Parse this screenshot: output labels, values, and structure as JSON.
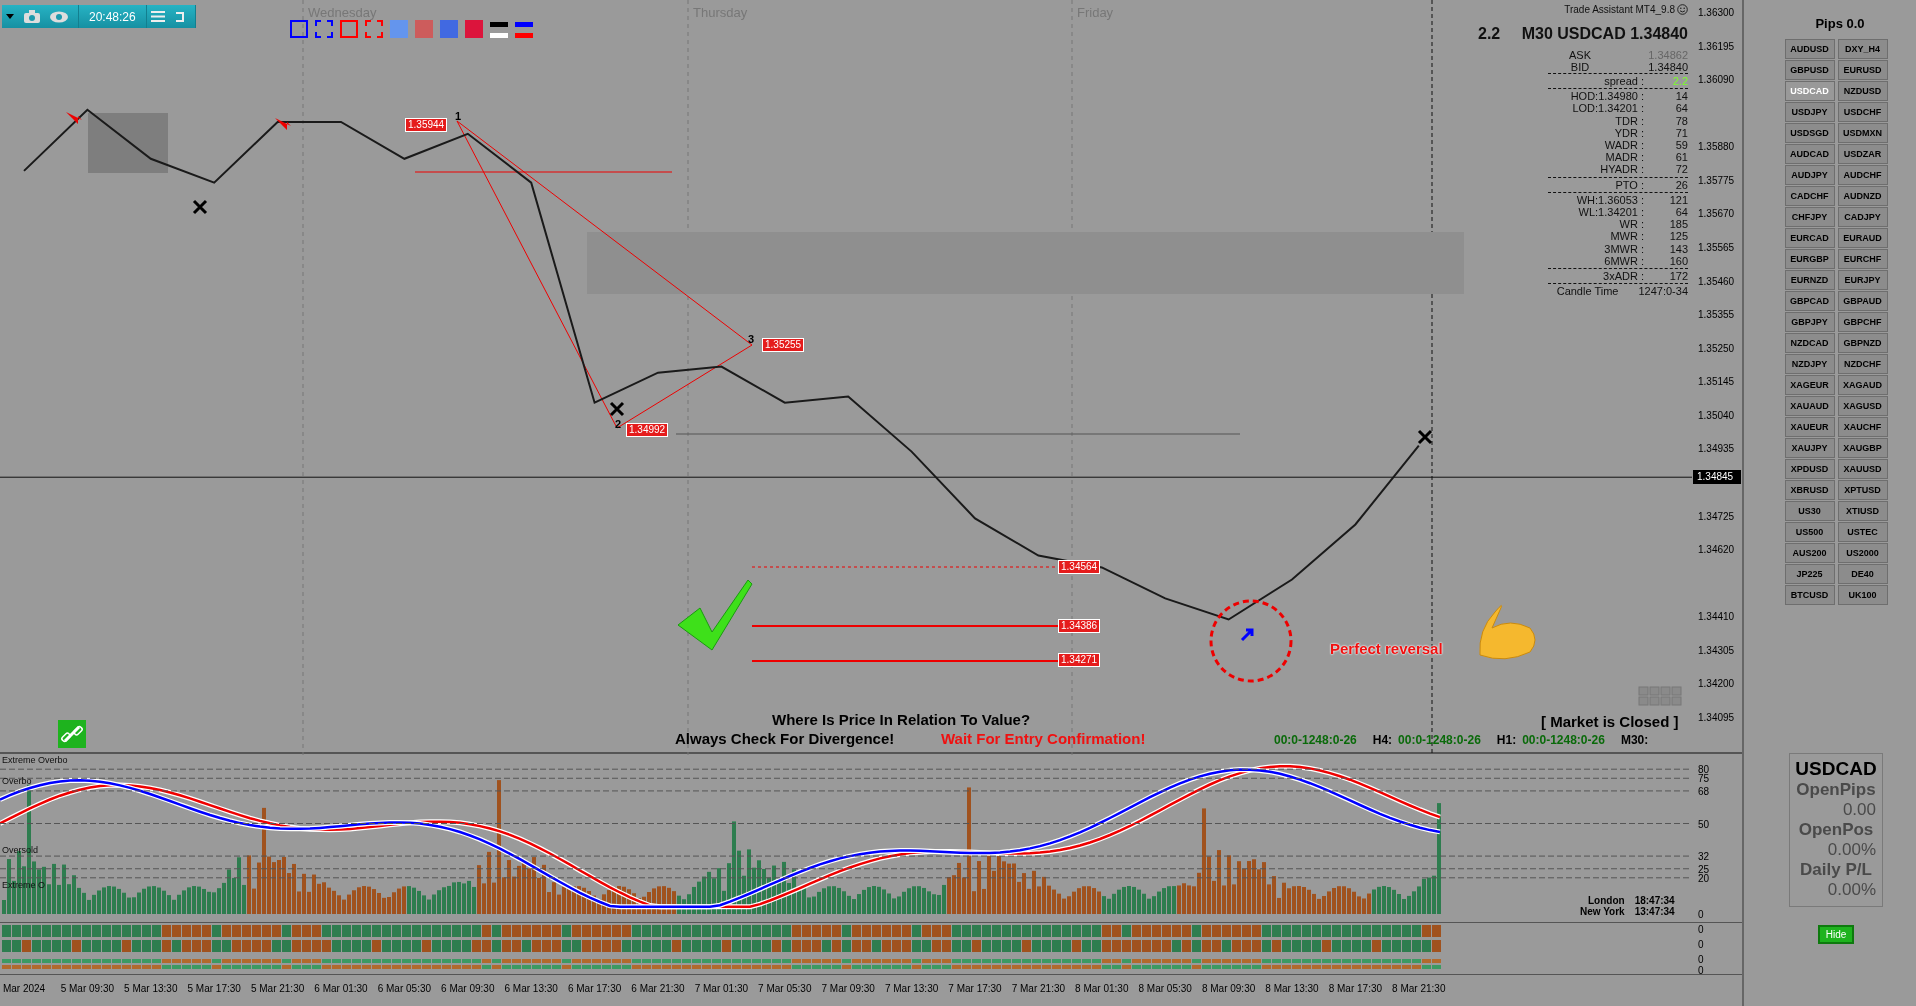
{
  "toolbar": {
    "clock": "20:48:26"
  },
  "swatches": [
    {
      "kind": "outline",
      "color": "#0000ff"
    },
    {
      "kind": "dashed",
      "color": "#0000ff"
    },
    {
      "kind": "outline",
      "color": "#ff0000"
    },
    {
      "kind": "dashed",
      "color": "#ff0000"
    },
    {
      "kind": "fill",
      "color": "#6495ed"
    },
    {
      "kind": "fill",
      "color": "#cd5c5c"
    },
    {
      "kind": "fill",
      "color": "#4169e1"
    },
    {
      "kind": "fill",
      "color": "#dc143c"
    },
    {
      "kind": "lines",
      "lines": [
        {
          "color": "#000000"
        },
        {
          "color": "#ffffff"
        }
      ]
    },
    {
      "kind": "lines",
      "lines": [
        {
          "color": "#0000ff"
        },
        {
          "color": "#ff0000"
        }
      ]
    }
  ],
  "chart": {
    "days": [
      "Wednesday",
      "Thursday",
      "Friday"
    ],
    "pivots": [
      "1",
      "2",
      "3"
    ],
    "price_labels": [
      "1.35944",
      "1.35255",
      "1.34992",
      "1.34564",
      "1.34386",
      "1.34271"
    ],
    "callout": "Perfect reversal",
    "current_price": "1.34845",
    "time_axis": [
      "Mar 2024",
      "5 Mar 09:30",
      "5 Mar 13:30",
      "5 Mar 17:30",
      "5 Mar 21:30",
      "6 Mar 01:30",
      "6 Mar 05:30",
      "6 Mar 09:30",
      "6 Mar 13:30",
      "6 Mar 17:30",
      "6 Mar 21:30",
      "7 Mar 01:30",
      "7 Mar 05:30",
      "7 Mar 09:30",
      "7 Mar 13:30",
      "7 Mar 17:30",
      "7 Mar 21:30",
      "8 Mar 01:30",
      "8 Mar 05:30",
      "8 Mar 09:30",
      "8 Mar 13:30",
      "8 Mar 17:30",
      "8 Mar 21:30"
    ],
    "price_axis": [
      "1.36300",
      "1.36195",
      "1.36090",
      "1.35880",
      "1.35775",
      "1.35670",
      "1.35565",
      "1.35460",
      "1.35355",
      "1.35250",
      "1.35145",
      "1.35040",
      "1.34935",
      "1.34725",
      "1.34620",
      "1.34410",
      "1.34305",
      "1.34200",
      "1.34095"
    ]
  },
  "info": {
    "source": "Trade Assistant MT4_9.8",
    "spread_big": "2.2",
    "headline": "M30 USDCAD 1.34840",
    "quotes": [
      {
        "label": "ASK",
        "value": "1.34862",
        "faded": true
      },
      {
        "label": "BID",
        "value": "1.34840",
        "faded": false
      }
    ],
    "groups": [
      [
        {
          "label": "spread :",
          "value": "2.2",
          "highlight": true
        }
      ],
      [
        {
          "label": "HOD:1.34980 :",
          "value": "14",
          "highlight": false
        },
        {
          "label": "LOD:1.34201 :",
          "value": "64",
          "highlight": false
        },
        {
          "label": "TDR :",
          "value": "78",
          "highlight": false
        },
        {
          "label": "YDR :",
          "value": "71",
          "highlight": false
        },
        {
          "label": "WADR :",
          "value": "59",
          "highlight": false
        },
        {
          "label": "MADR :",
          "value": "61",
          "highlight": false
        },
        {
          "label": "HYADR :",
          "value": "72",
          "highlight": false
        }
      ],
      [
        {
          "label": "PTO :",
          "value": "26",
          "highlight": false
        }
      ],
      [
        {
          "label": "WH:1.36053 :",
          "value": "121",
          "highlight": false
        },
        {
          "label": "WL:1.34201 :",
          "value": "64",
          "highlight": false
        },
        {
          "label": "WR :",
          "value": "185",
          "highlight": false
        },
        {
          "label": "MWR :",
          "value": "125",
          "highlight": false
        },
        {
          "label": "3MWR :",
          "value": "143",
          "highlight": false
        },
        {
          "label": "6MWR :",
          "value": "160",
          "highlight": false
        }
      ],
      [
        {
          "label": "3xADR :",
          "value": "172",
          "highlight": false
        }
      ],
      [
        {
          "label": "Candle Time",
          "value": "1247:0-34",
          "highlight": false
        }
      ]
    ]
  },
  "messages": {
    "question": "Where Is Price In Relation To Value?",
    "divergence": "Always Check For Divergence!",
    "confirmation": "Wait For Entry Confirmation!",
    "market": "[ Market is Closed ]"
  },
  "timeframes": [
    {
      "value": "00:0-1248:0-26"
    },
    {
      "label": "H4:",
      "value": "00:0-1248:0-26"
    },
    {
      "label": "H1:",
      "value": "00:0-1248:0-26"
    },
    {
      "label": "M30:"
    }
  ],
  "oscillator": {
    "levels": [
      "Extreme Overbo",
      "Overbo",
      "Oversold",
      "Extreme O"
    ],
    "scale": [
      "80",
      "75",
      "68",
      "50",
      "32",
      "25",
      "20",
      "0"
    ],
    "sessions": [
      {
        "city": "London",
        "time": "18:47:34"
      },
      {
        "city": "New York",
        "time": "13:47:34"
      }
    ]
  },
  "strips": {
    "scale": [
      "0",
      "0",
      "0",
      "0"
    ]
  },
  "sidebar": {
    "title": "Pips 0.0",
    "symbols": [
      {
        "label": "AUDUSD",
        "selected": false
      },
      {
        "label": "DXY_H4",
        "selected": false
      },
      {
        "label": "GBPUSD",
        "selected": false
      },
      {
        "label": "EURUSD",
        "selected": false
      },
      {
        "label": "USDCAD",
        "selected": true
      },
      {
        "label": "NZDUSD",
        "selected": false
      },
      {
        "label": "USDJPY",
        "selected": false
      },
      {
        "label": "USDCHF",
        "selected": false
      },
      {
        "label": "USDSGD",
        "selected": false
      },
      {
        "label": "USDMXN",
        "selected": false
      },
      {
        "label": "AUDCAD",
        "selected": false
      },
      {
        "label": "USDZAR",
        "selected": false
      },
      {
        "label": "AUDJPY",
        "selected": false
      },
      {
        "label": "AUDCHF",
        "selected": false
      },
      {
        "label": "CADCHF",
        "selected": false
      },
      {
        "label": "AUDNZD",
        "selected": false
      },
      {
        "label": "CHFJPY",
        "selected": false
      },
      {
        "label": "CADJPY",
        "selected": false
      },
      {
        "label": "EURCAD",
        "selected": false
      },
      {
        "label": "EURAUD",
        "selected": false
      },
      {
        "label": "EURGBP",
        "selected": false
      },
      {
        "label": "EURCHF",
        "selected": false
      },
      {
        "label": "EURNZD",
        "selected": false
      },
      {
        "label": "EURJPY",
        "selected": false
      },
      {
        "label": "GBPCAD",
        "selected": false
      },
      {
        "label": "GBPAUD",
        "selected": false
      },
      {
        "label": "GBPJPY",
        "selected": false
      },
      {
        "label": "GBPCHF",
        "selected": false
      },
      {
        "label": "NZDCAD",
        "selected": false
      },
      {
        "label": "GBPNZD",
        "selected": false
      },
      {
        "label": "NZDJPY",
        "selected": false
      },
      {
        "label": "NZDCHF",
        "selected": false
      },
      {
        "label": "XAGEUR",
        "selected": false
      },
      {
        "label": "XAGAUD",
        "selected": false
      },
      {
        "label": "XAUAUD",
        "selected": false
      },
      {
        "label": "XAGUSD",
        "selected": false
      },
      {
        "label": "XAUEUR",
        "selected": false
      },
      {
        "label": "XAUCHF",
        "selected": false
      },
      {
        "label": "XAUJPY",
        "selected": false
      },
      {
        "label": "XAUGBP",
        "selected": false
      },
      {
        "label": "XPDUSD",
        "selected": false
      },
      {
        "label": "XAUUSD",
        "selected": false
      },
      {
        "label": "XBRUSD",
        "selected": false
      },
      {
        "label": "XPTUSD",
        "selected": false
      },
      {
        "label": "US30",
        "selected": false
      },
      {
        "label": "XTIUSD",
        "selected": false
      },
      {
        "label": "US500",
        "selected": false
      },
      {
        "label": "USTEC",
        "selected": false
      },
      {
        "label": "AUS200",
        "selected": false
      },
      {
        "label": "US2000",
        "selected": false
      },
      {
        "label": "JP225",
        "selected": false
      },
      {
        "label": "DE40",
        "selected": false
      },
      {
        "label": "BTCUSD",
        "selected": false
      },
      {
        "label": "UK100",
        "selected": false
      }
    ],
    "summary": {
      "symbol": "USDCAD",
      "rows": [
        {
          "label": "OpenPips",
          "value": "0.00"
        },
        {
          "label": "OpenPos",
          "value": "0.00%"
        },
        {
          "label": "Daily P/L",
          "value": "0.00%"
        }
      ]
    },
    "hide": "Hide"
  }
}
